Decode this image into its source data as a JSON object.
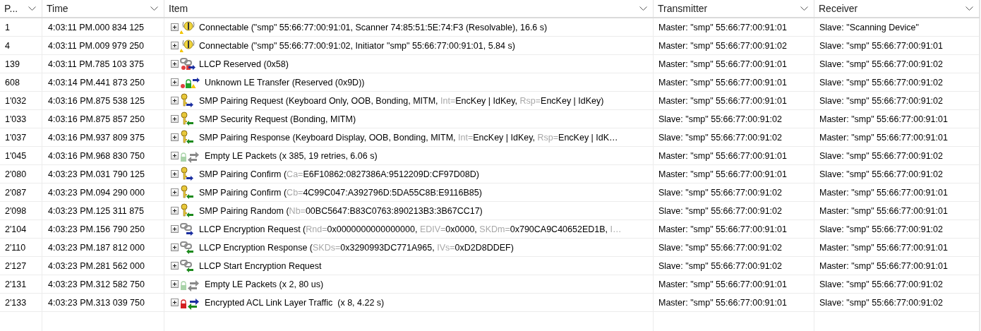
{
  "table": {
    "columns": [
      {
        "label": "P..."
      },
      {
        "label": "Time"
      },
      {
        "label": "Item"
      },
      {
        "label": "Transmitter"
      },
      {
        "label": "Receiver"
      }
    ],
    "rows": [
      {
        "packet": "1",
        "time": "4:03:11 PM.000 834 125",
        "kind": "advert",
        "item": [
          {
            "text": "Connectable (\"smp\" 55:66:77:00:91:01, Scanner 74:85:51:5E:74:F3 (Resolvable), 16.6 s)",
            "dim": false
          }
        ],
        "transmitter": "Master: \"smp\" 55:66:77:00:91:01",
        "receiver": "Slave: \"Scanning Device\""
      },
      {
        "packet": "4",
        "time": "4:03:11 PM.009 979 250",
        "kind": "advert",
        "item": [
          {
            "text": "Connectable (\"smp\" 55:66:77:00:91:02, Initiator \"smp\" 55:66:77:00:91:01, 5.84 s)",
            "dim": false
          }
        ],
        "transmitter": "Master: \"smp\" 55:66:77:00:91:02",
        "receiver": "Slave: \"smp\" 55:66:77:00:91:01"
      },
      {
        "packet": "139",
        "time": "4:03:11 PM.785 103 375",
        "kind": "llcp-error",
        "item": [
          {
            "text": "LLCP Reserved (0x58)",
            "dim": false
          }
        ],
        "transmitter": "Master: \"smp\" 55:66:77:00:91:01",
        "receiver": "Slave: \"smp\" 55:66:77:00:91:02"
      },
      {
        "packet": "608",
        "time": "4:03:14 PM.441 873 250",
        "kind": "unknown",
        "item": [
          {
            "text": "Unknown LE Transfer (Reserved (0x9D))",
            "dim": false
          }
        ],
        "transmitter": "Master: \"smp\" 55:66:77:00:91:01",
        "receiver": "Slave: \"smp\" 55:66:77:00:91:02"
      },
      {
        "packet": "1'032",
        "time": "4:03:16 PM.875 538 125",
        "kind": "smp-out",
        "item": [
          {
            "text": "SMP Pairing Request (Keyboard Only, OOB, Bonding, MITM, ",
            "dim": false
          },
          {
            "text": "Int=",
            "dim": true
          },
          {
            "text": "EncKey | IdKey, ",
            "dim": false
          },
          {
            "text": "Rsp=",
            "dim": true
          },
          {
            "text": "EncKey | IdKey)",
            "dim": false
          }
        ],
        "transmitter": "Master: \"smp\" 55:66:77:00:91:01",
        "receiver": "Slave: \"smp\" 55:66:77:00:91:02"
      },
      {
        "packet": "1'033",
        "time": "4:03:16 PM.875 857 250",
        "kind": "smp-in",
        "item": [
          {
            "text": "SMP Security Request (Bonding, MITM)",
            "dim": false
          }
        ],
        "transmitter": "Slave: \"smp\" 55:66:77:00:91:02",
        "receiver": "Master: \"smp\" 55:66:77:00:91:01"
      },
      {
        "packet": "1'037",
        "time": "4:03:16 PM.937 809 375",
        "kind": "smp-in",
        "item": [
          {
            "text": "SMP Pairing Response (Keyboard Display, OOB, Bonding, MITM, ",
            "dim": false
          },
          {
            "text": "Int=",
            "dim": true
          },
          {
            "text": "EncKey | IdKey, ",
            "dim": false
          },
          {
            "text": "Rsp=",
            "dim": true
          },
          {
            "text": "EncKey | IdK…",
            "dim": false
          }
        ],
        "transmitter": "Slave: \"smp\" 55:66:77:00:91:02",
        "receiver": "Master: \"smp\" 55:66:77:00:91:01"
      },
      {
        "packet": "1'045",
        "time": "4:03:16 PM.968 830 750",
        "kind": "empty",
        "item": [
          {
            "text": "Empty LE Packets (x 385, 19 retries, 6.06 s)",
            "dim": false
          }
        ],
        "transmitter": "Master: \"smp\" 55:66:77:00:91:01",
        "receiver": "Slave: \"smp\" 55:66:77:00:91:02"
      },
      {
        "packet": "2'080",
        "time": "4:03:23 PM.031 790 125",
        "kind": "smp-out",
        "item": [
          {
            "text": "SMP Pairing Confirm (",
            "dim": false
          },
          {
            "text": "Ca=",
            "dim": true
          },
          {
            "text": "E6F10862:0827386A:9512209D:CF97D08D)",
            "dim": false
          }
        ],
        "transmitter": "Master: \"smp\" 55:66:77:00:91:01",
        "receiver": "Slave: \"smp\" 55:66:77:00:91:02"
      },
      {
        "packet": "2'087",
        "time": "4:03:23 PM.094 290 000",
        "kind": "smp-in",
        "item": [
          {
            "text": "SMP Pairing Confirm (",
            "dim": false
          },
          {
            "text": "Cb=",
            "dim": true
          },
          {
            "text": "4C99C047:A392796D:5DA55C8B:E9116B85)",
            "dim": false
          }
        ],
        "transmitter": "Slave: \"smp\" 55:66:77:00:91:02",
        "receiver": "Master: \"smp\" 55:66:77:00:91:01"
      },
      {
        "packet": "2'098",
        "time": "4:03:23 PM.125 311 875",
        "kind": "smp-in",
        "item": [
          {
            "text": "SMP Pairing Random (",
            "dim": false
          },
          {
            "text": "Nb=",
            "dim": true
          },
          {
            "text": "00BC5647:B83C0763:890213B3:3B67CC17)",
            "dim": false
          }
        ],
        "transmitter": "Slave: \"smp\" 55:66:77:00:91:02",
        "receiver": "Master: \"smp\" 55:66:77:00:91:01"
      },
      {
        "packet": "2'104",
        "time": "4:03:23 PM.156 790 250",
        "kind": "llcp-out",
        "item": [
          {
            "text": "LLCP Encryption Request (",
            "dim": false
          },
          {
            "text": "Rnd=",
            "dim": true
          },
          {
            "text": "0x0000000000000000, ",
            "dim": false
          },
          {
            "text": "EDIV=",
            "dim": true
          },
          {
            "text": "0x0000, ",
            "dim": false
          },
          {
            "text": "SKDm=",
            "dim": true
          },
          {
            "text": "0x790CA9C40652ED1B, ",
            "dim": false
          },
          {
            "text": "I…",
            "dim": true
          }
        ],
        "transmitter": "Master: \"smp\" 55:66:77:00:91:01",
        "receiver": "Slave: \"smp\" 55:66:77:00:91:02"
      },
      {
        "packet": "2'110",
        "time": "4:03:23 PM.187 812 000",
        "kind": "llcp-in",
        "item": [
          {
            "text": "LLCP Encryption Response (",
            "dim": false
          },
          {
            "text": "SKDs=",
            "dim": true
          },
          {
            "text": "0x3290993DC771A965, ",
            "dim": false
          },
          {
            "text": "IVs=",
            "dim": true
          },
          {
            "text": "0xD2D8DDEF)",
            "dim": false
          }
        ],
        "transmitter": "Slave: \"smp\" 55:66:77:00:91:02",
        "receiver": "Master: \"smp\" 55:66:77:00:91:01"
      },
      {
        "packet": "2'127",
        "time": "4:03:23 PM.281 562 000",
        "kind": "llcp-in",
        "item": [
          {
            "text": "LLCP Start Encryption Request",
            "dim": false
          }
        ],
        "transmitter": "Slave: \"smp\" 55:66:77:00:91:02",
        "receiver": "Master: \"smp\" 55:66:77:00:91:01"
      },
      {
        "packet": "2'131",
        "time": "4:03:23 PM.312 582 750",
        "kind": "empty",
        "item": [
          {
            "text": "Empty LE Packets (x 2, 80 us)",
            "dim": false
          }
        ],
        "transmitter": "Master: \"smp\" 55:66:77:00:91:01",
        "receiver": "Slave: \"smp\" 55:66:77:00:91:02"
      },
      {
        "packet": "2'133",
        "time": "4:03:23 PM.313 039 750",
        "kind": "encrypted",
        "item": [
          {
            "text": "Encrypted ACL Link Layer Traffic  (x 8, 4.22 s)",
            "dim": false
          }
        ],
        "transmitter": "Master: \"smp\" 55:66:77:00:91:01",
        "receiver": "Slave: \"smp\" 55:66:77:00:91:02"
      }
    ]
  }
}
